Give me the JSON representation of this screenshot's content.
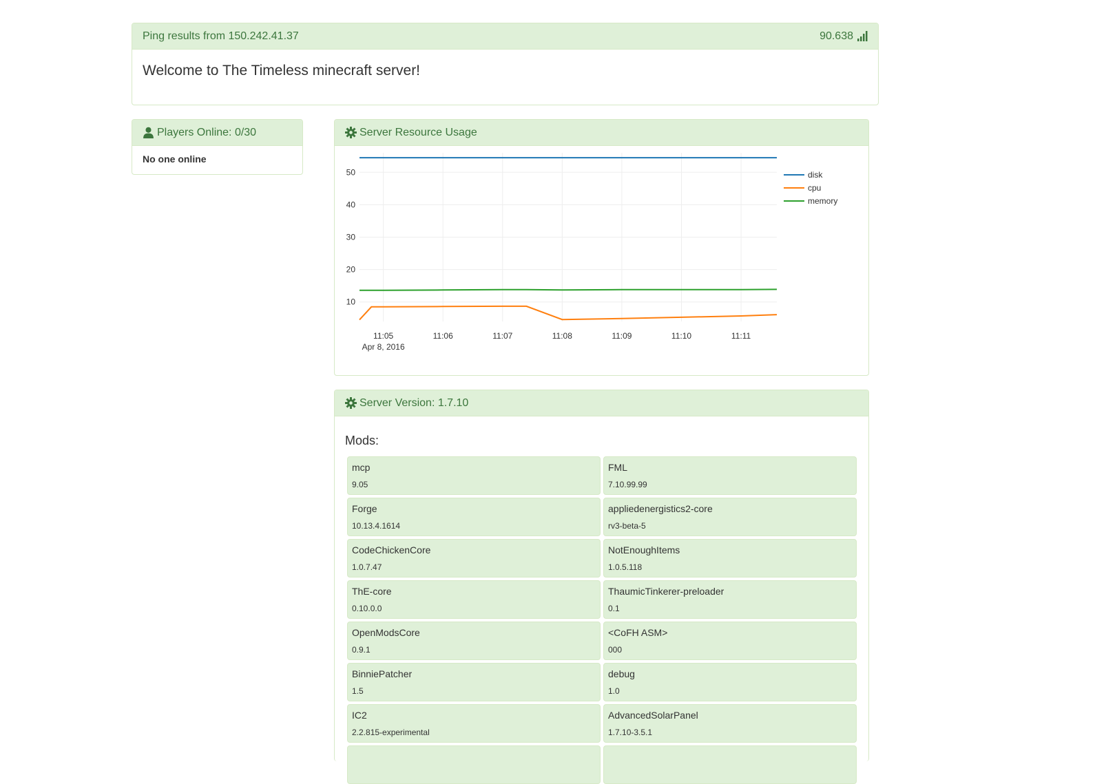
{
  "ping": {
    "title": "Ping results from 150.242.41.37",
    "value": "90.638",
    "welcome": "Welcome to The Timeless minecraft server!"
  },
  "players": {
    "title": "Players Online: 0/30",
    "status": "No one online"
  },
  "usage": {
    "title": "Server Resource Usage"
  },
  "version": {
    "title": "Server Version: 1.7.10",
    "mods_title": "Mods:"
  },
  "mods": [
    {
      "name": "mcp",
      "version": "9.05"
    },
    {
      "name": "FML",
      "version": "7.10.99.99"
    },
    {
      "name": "Forge",
      "version": "10.13.4.1614"
    },
    {
      "name": "appliedenergistics2-core",
      "version": "rv3-beta-5"
    },
    {
      "name": "CodeChickenCore",
      "version": "1.0.7.47"
    },
    {
      "name": "NotEnoughItems",
      "version": "1.0.5.118"
    },
    {
      "name": "ThE-core",
      "version": "0.10.0.0"
    },
    {
      "name": "ThaumicTinkerer-preloader",
      "version": "0.1"
    },
    {
      "name": "OpenModsCore",
      "version": "0.9.1"
    },
    {
      "name": "<CoFH ASM>",
      "version": "000"
    },
    {
      "name": "BinniePatcher",
      "version": "1.5"
    },
    {
      "name": "debug",
      "version": "1.0"
    },
    {
      "name": "IC2",
      "version": "2.2.815-experimental"
    },
    {
      "name": "AdvancedSolarPanel",
      "version": "1.7.10-3.5.1"
    },
    {
      "name": "",
      "version": ""
    },
    {
      "name": "",
      "version": ""
    }
  ],
  "icons": {
    "signal": "signal-bars-icon",
    "user": "user-icon",
    "gear": "gear-icon"
  },
  "colors": {
    "heading_bg": "#dff0d8",
    "heading_text": "#3c763d",
    "border": "#d6e9c6"
  },
  "chart_data": {
    "type": "line",
    "x": [
      "11:04.6",
      "11:04.8",
      "11:05",
      "11:06",
      "11:07",
      "11:07.4",
      "11:08",
      "11:09",
      "11:10",
      "11:11",
      "11:11.6"
    ],
    "xticks": [
      "11:05",
      "11:06",
      "11:07",
      "11:08",
      "11:09",
      "11:10",
      "11:11"
    ],
    "xtick_sublabel": "Apr 8, 2016",
    "yticks": [
      10,
      20,
      30,
      40,
      50
    ],
    "ylim": [
      4,
      56
    ],
    "series": [
      {
        "name": "disk",
        "color": "#1f77b4",
        "values": [
          54.5,
          54.5,
          54.5,
          54.5,
          54.5,
          54.5,
          54.5,
          54.5,
          54.5,
          54.5,
          54.5
        ]
      },
      {
        "name": "cpu",
        "color": "#ff7f0e",
        "values": [
          4.5,
          8.5,
          8.5,
          8.6,
          8.7,
          8.7,
          4.6,
          4.9,
          5.3,
          5.7,
          6.1
        ]
      },
      {
        "name": "memory",
        "color": "#2ca02c",
        "values": [
          13.6,
          13.6,
          13.6,
          13.7,
          13.8,
          13.8,
          13.7,
          13.8,
          13.8,
          13.8,
          13.9
        ]
      }
    ],
    "legend": "top-right",
    "grid": true
  }
}
